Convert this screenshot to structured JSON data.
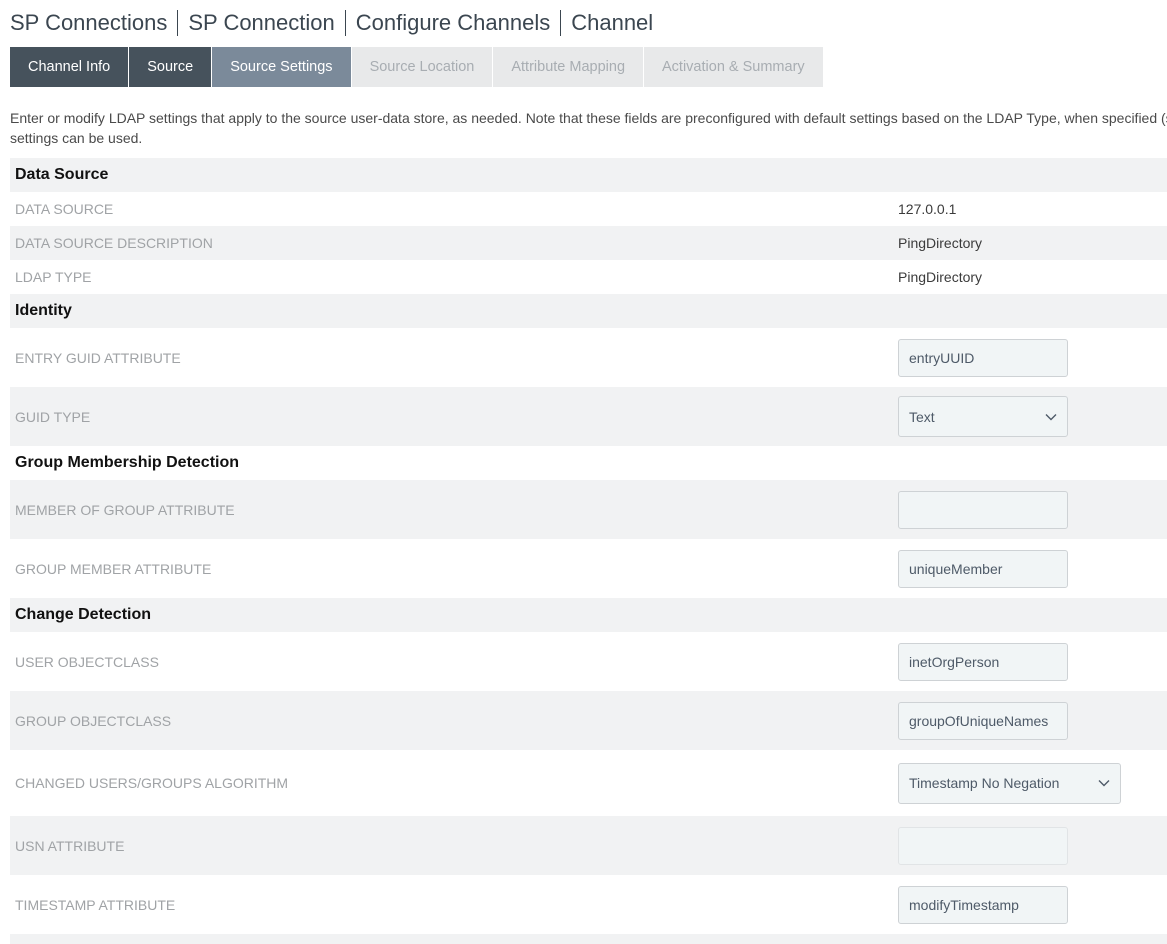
{
  "breadcrumb": [
    "SP Connections",
    "SP Connection",
    "Configure Channels",
    "Channel"
  ],
  "tabs": [
    {
      "label": "Channel Info",
      "state": "done"
    },
    {
      "label": "Source",
      "state": "done"
    },
    {
      "label": "Source Settings",
      "state": "active"
    },
    {
      "label": "Source Location",
      "state": "pending"
    },
    {
      "label": "Attribute Mapping",
      "state": "pending"
    },
    {
      "label": "Activation & Summary",
      "state": "pending"
    }
  ],
  "intro": {
    "line1": "Enter or modify LDAP settings that apply to the source user-data store, as needed. Note that these fields are preconfigured with default settings based on the LDAP Type, when specified (s",
    "line2": "settings can be used."
  },
  "sections": {
    "data_source": {
      "title": "Data Source",
      "data_source": {
        "label": "DATA SOURCE",
        "value": "127.0.0.1"
      },
      "description": {
        "label": "DATA SOURCE DESCRIPTION",
        "value": "PingDirectory"
      },
      "ldap_type": {
        "label": "LDAP TYPE",
        "value": "PingDirectory"
      }
    },
    "identity": {
      "title": "Identity",
      "entry_guid": {
        "label": "ENTRY GUID ATTRIBUTE",
        "value": "entryUUID"
      },
      "guid_type": {
        "label": "GUID TYPE",
        "value": "Text"
      }
    },
    "group_membership": {
      "title": "Group Membership Detection",
      "member_of_group": {
        "label": "MEMBER OF GROUP ATTRIBUTE",
        "value": ""
      },
      "group_member": {
        "label": "GROUP MEMBER ATTRIBUTE",
        "value": "uniqueMember"
      }
    },
    "change_detection": {
      "title": "Change Detection",
      "user_objectclass": {
        "label": "USER OBJECTCLASS",
        "value": "inetOrgPerson"
      },
      "group_objectclass": {
        "label": "GROUP OBJECTCLASS",
        "value": "groupOfUniqueNames"
      },
      "algorithm": {
        "label": "CHANGED USERS/GROUPS ALGORITHM",
        "value": "Timestamp No Negation"
      },
      "usn_attribute": {
        "label": "USN ATTRIBUTE",
        "value": "",
        "disabled": true
      },
      "timestamp_attribute": {
        "label": "TIMESTAMP ATTRIBUTE",
        "value": "modifyTimestamp"
      }
    }
  },
  "icons": {
    "select_arrow": "chevron-down-icon"
  }
}
